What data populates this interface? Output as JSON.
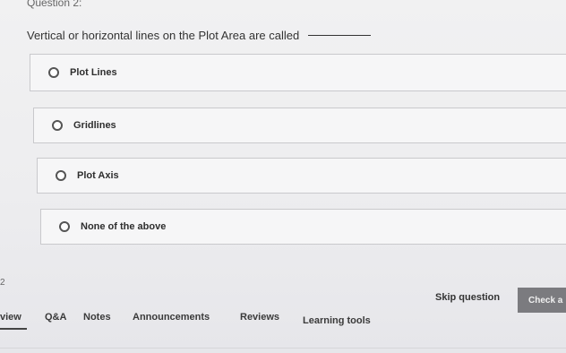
{
  "question": {
    "header": "Question 2:",
    "text": "Vertical or horizontal lines on the Plot Area are called"
  },
  "options": [
    {
      "label": "Plot Lines"
    },
    {
      "label": "Gridlines"
    },
    {
      "label": "Plot Axis"
    },
    {
      "label": "None of the above"
    }
  ],
  "footer": {
    "page": "2",
    "skip_label": "Skip question",
    "check_label": "Check a"
  },
  "nav": {
    "items": [
      "view",
      "Q&A",
      "Notes",
      "Announcements",
      "Reviews",
      "Learning tools"
    ]
  }
}
